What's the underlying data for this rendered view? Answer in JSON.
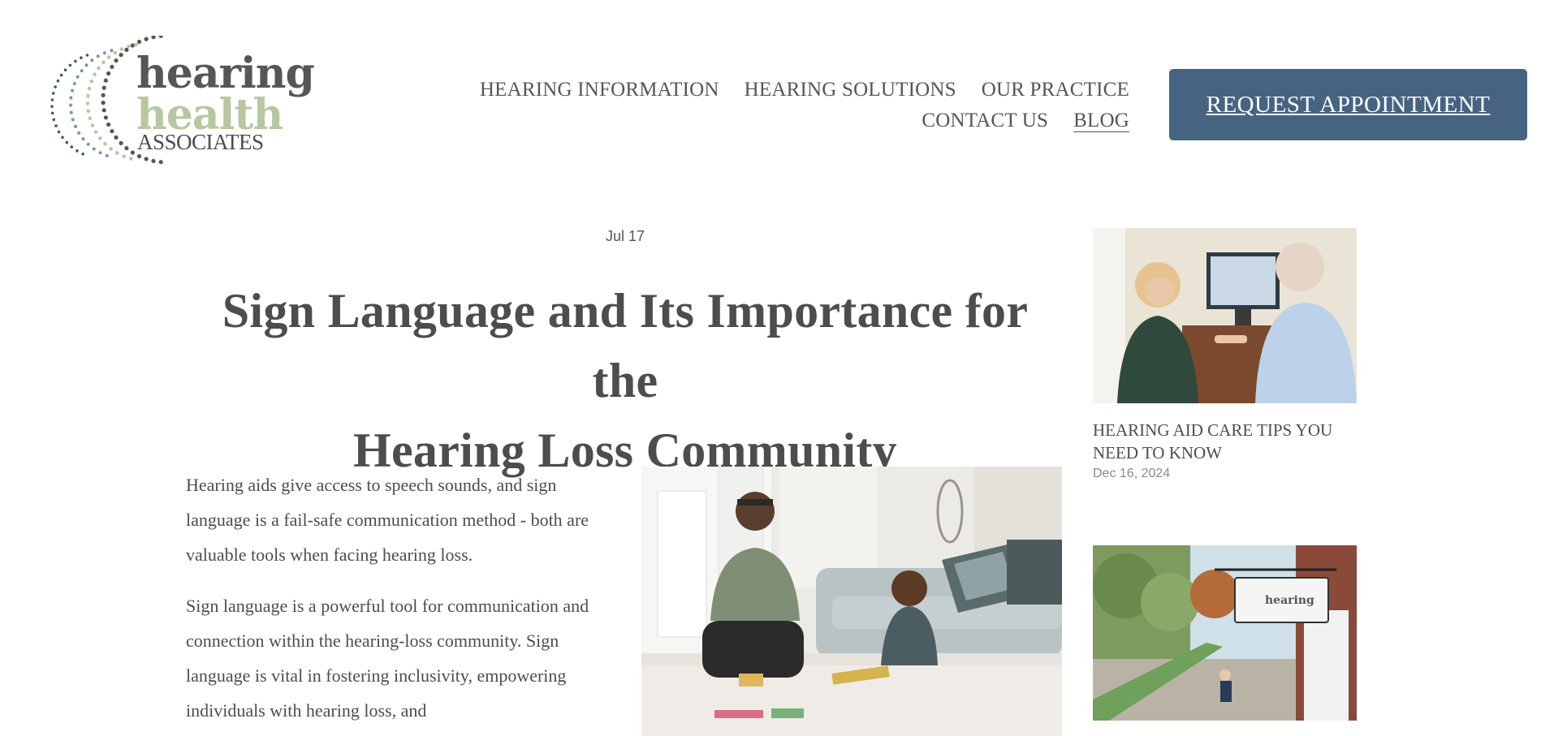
{
  "logo": {
    "word1": "hearing",
    "word2": "health",
    "word3": "ASSOCIATES",
    "colors": {
      "gray": "#565656",
      "green": "#b7c79f",
      "blue": "#7593b4",
      "navy": "#3e5878"
    }
  },
  "nav": {
    "items": [
      {
        "label": "HEARING INFORMATION"
      },
      {
        "label": "HEARING SOLUTIONS"
      },
      {
        "label": "OUR PRACTICE"
      },
      {
        "label": "CONTACT US"
      },
      {
        "label": "BLOG",
        "active": true
      }
    ],
    "cta_label": "REQUEST APPOINTMENT",
    "cta_color": "#466482"
  },
  "article": {
    "date": "Jul 17",
    "title_line1": "Sign Language and Its Importance for the",
    "title_line2": "Hearing Loss Community",
    "paragraphs": [
      "Hearing aids give access to speech sounds, and sign language is a fail-safe communication method - both are valuable tools when facing hearing loss.",
      "Sign language is a powerful tool for communication and connection within the hearing-loss community. Sign language is vital in fostering inclusivity, empowering individuals with hearing loss, and"
    ]
  },
  "sidebar": {
    "posts": [
      {
        "title": "HEARING AID CARE TIPS YOU NEED TO KNOW",
        "date": "Dec 16, 2024"
      }
    ]
  }
}
